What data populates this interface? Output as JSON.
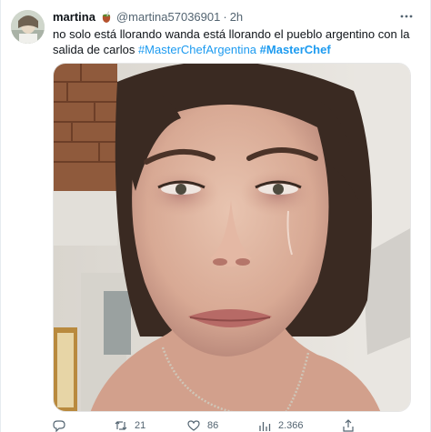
{
  "user": {
    "display_name": "martina",
    "handle": "@martina57036901",
    "separator": "·",
    "time": "2h",
    "name_emoji": "mate-icon"
  },
  "tweet": {
    "text_part1": "no solo está llorando wanda está llorando el pueblo argentino con la salida de carlos ",
    "hashtag1": "#MasterChefArgentina",
    "hashtag2": "#MasterChef"
  },
  "media": {
    "type": "photo",
    "subject": "woman-crying-photo"
  },
  "actions": {
    "reply": {
      "icon": "reply-icon",
      "count": ""
    },
    "retweet": {
      "icon": "retweet-icon",
      "count": "21"
    },
    "like": {
      "icon": "heart-icon",
      "count": "86"
    },
    "views": {
      "icon": "views-icon",
      "count": "2.366"
    },
    "share": {
      "icon": "share-icon",
      "count": ""
    }
  },
  "colors": {
    "link": "#1d9bf0",
    "text": "#0f1419",
    "secondary": "#536471"
  }
}
